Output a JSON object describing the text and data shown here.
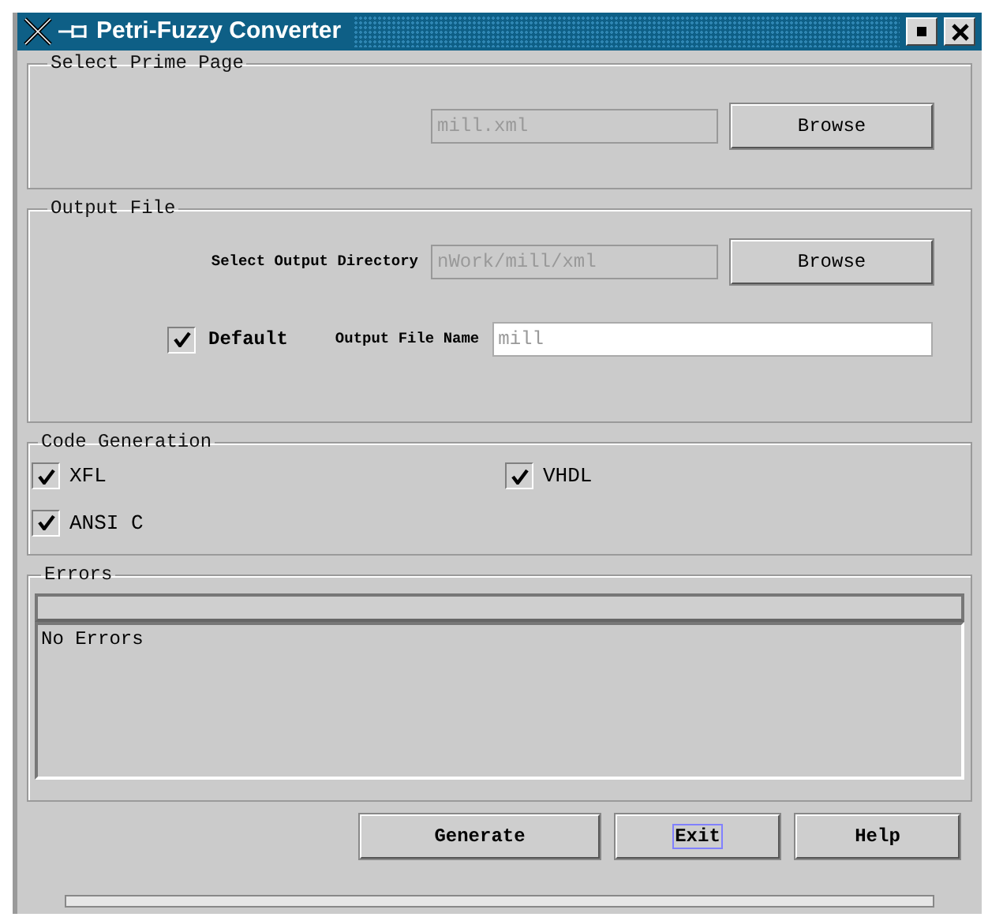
{
  "window": {
    "title": "Petri-Fuzzy Converter"
  },
  "prime_page": {
    "title": "Select Prime Page",
    "file": {
      "value": "mill.xml"
    },
    "browse_button": "Browse"
  },
  "output_file": {
    "title": "Output File",
    "directory_label": "Select Output Directory",
    "directory": {
      "value": "nWork/mill/xml"
    },
    "browse_button": "Browse",
    "default_checkbox": {
      "label": "Default",
      "checked": true
    },
    "file_name_label": "Output File Name",
    "file_name": {
      "value": "mill"
    }
  },
  "code_generation": {
    "title": "Code Generation",
    "options": [
      {
        "label": "XFL",
        "checked": true
      },
      {
        "label": "VHDL",
        "checked": true
      },
      {
        "label": "ANSI C",
        "checked": true
      }
    ]
  },
  "errors": {
    "title": "Errors",
    "text": "No Errors"
  },
  "buttons": [
    {
      "label": "Generate",
      "focused": false
    },
    {
      "label": "Exit",
      "focused": true
    },
    {
      "label": "Help",
      "focused": false
    }
  ]
}
